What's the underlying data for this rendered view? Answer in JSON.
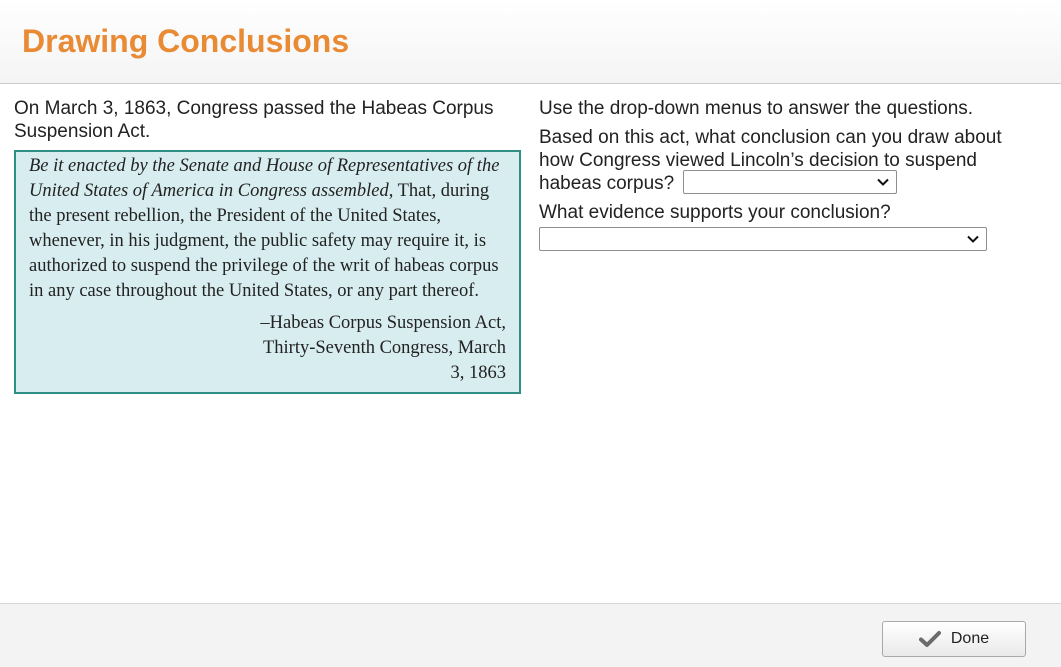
{
  "header": {
    "title": "Drawing Conclusions",
    "title_color": "#e98a35"
  },
  "left": {
    "intro": "On March 3, 1863, Congress passed the Habeas Corpus Suspension Act.",
    "quote": {
      "italic_part": "Be it enacted by the Senate and House of Representatives of the United States of America in Congress assembled",
      "body": ", That, during the present rebellion, the President of the United States, whenever, in his judgment, the public safety may require it, is authorized to suspend the privilege of the writ of habeas corpus in any case throughout the United States, or any part thereof.",
      "attribution": "–Habeas Corpus Suspension Act, Thirty-Seventh Congress, March 3, 1863",
      "background": "#d8edef",
      "border": "#2f8f85"
    }
  },
  "right": {
    "instructions": "Use the drop-down menus to answer the questions.",
    "question1": "Based on this act, what conclusion can you draw about how Congress viewed Lincoln’s decision to suspend habeas corpus?",
    "question1_selected": "",
    "question2": "What evidence supports your conclusion?",
    "question2_selected": ""
  },
  "footer": {
    "done_label": "Done",
    "done_icon": "checkmark-icon"
  }
}
